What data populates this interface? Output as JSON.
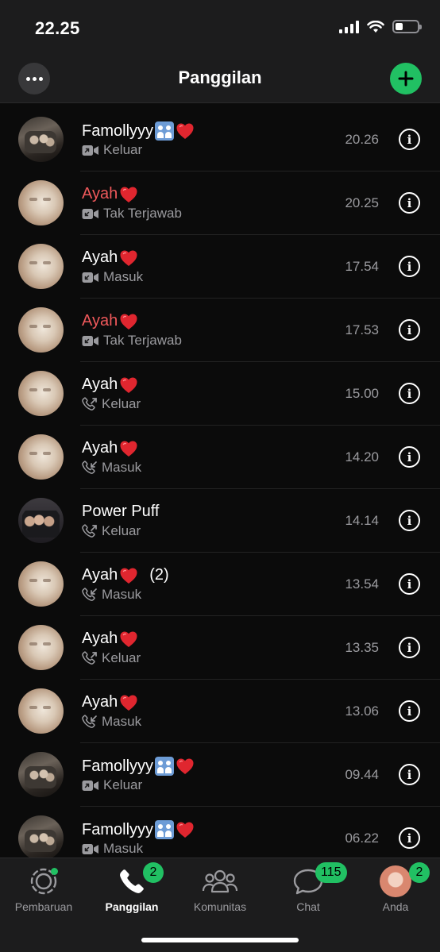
{
  "status_bar": {
    "time": "22.25"
  },
  "header": {
    "title": "Panggilan",
    "more_icon": "ellipsis-icon",
    "add_icon": "plus-icon"
  },
  "calls": [
    {
      "name": "Famollyyy",
      "emoji": "family-heart",
      "type": "Keluar",
      "media": "video",
      "direction": "out",
      "time": "20.26",
      "missed": false,
      "avatar": "group"
    },
    {
      "name": "Ayah",
      "emoji": "heart",
      "type": "Tak Terjawab",
      "media": "video",
      "direction": "in",
      "time": "20.25",
      "missed": true,
      "avatar": "cat"
    },
    {
      "name": "Ayah",
      "emoji": "heart",
      "type": "Masuk",
      "media": "video",
      "direction": "in",
      "time": "17.54",
      "missed": false,
      "avatar": "cat"
    },
    {
      "name": "Ayah",
      "emoji": "heart",
      "type": "Tak Terjawab",
      "media": "video",
      "direction": "in",
      "time": "17.53",
      "missed": true,
      "avatar": "cat"
    },
    {
      "name": "Ayah",
      "emoji": "heart",
      "type": "Keluar",
      "media": "voice",
      "direction": "out",
      "time": "15.00",
      "missed": false,
      "avatar": "cat"
    },
    {
      "name": "Ayah",
      "emoji": "heart",
      "type": "Masuk",
      "media": "voice",
      "direction": "in",
      "time": "14.20",
      "missed": false,
      "avatar": "cat"
    },
    {
      "name": "Power Puff",
      "emoji": "",
      "type": "Keluar",
      "media": "voice",
      "direction": "out",
      "time": "14.14",
      "missed": false,
      "avatar": "puff"
    },
    {
      "name": "Ayah",
      "emoji": "heart",
      "count": "(2)",
      "type": "Masuk",
      "media": "voice",
      "direction": "in",
      "time": "13.54",
      "missed": false,
      "avatar": "cat"
    },
    {
      "name": "Ayah",
      "emoji": "heart",
      "type": "Keluar",
      "media": "voice",
      "direction": "out",
      "time": "13.35",
      "missed": false,
      "avatar": "cat"
    },
    {
      "name": "Ayah",
      "emoji": "heart",
      "type": "Masuk",
      "media": "voice",
      "direction": "in",
      "time": "13.06",
      "missed": false,
      "avatar": "cat"
    },
    {
      "name": "Famollyyy",
      "emoji": "family-heart",
      "type": "Keluar",
      "media": "video",
      "direction": "out",
      "time": "09.44",
      "missed": false,
      "avatar": "group"
    },
    {
      "name": "Famollyyy",
      "emoji": "family-heart",
      "type": "Masuk",
      "media": "video",
      "direction": "in",
      "time": "06.22",
      "missed": false,
      "avatar": "group"
    }
  ],
  "tabs": [
    {
      "label": "Pembaruan",
      "icon": "updates-icon",
      "badge": "",
      "active": false
    },
    {
      "label": "Panggilan",
      "icon": "phone-icon",
      "badge": "2",
      "active": true
    },
    {
      "label": "Komunitas",
      "icon": "community-icon",
      "badge": "",
      "active": false
    },
    {
      "label": "Chat",
      "icon": "chat-icon",
      "badge": "115",
      "active": false
    },
    {
      "label": "Anda",
      "icon": "profile-avatar",
      "badge": "2",
      "active": false
    }
  ],
  "colors": {
    "accent": "#21c063",
    "missed": "#f0595b",
    "secondary_text": "#9b9b9f",
    "background": "#0b0b0b"
  }
}
